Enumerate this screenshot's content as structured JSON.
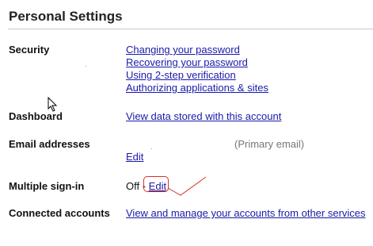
{
  "page": {
    "title": "Personal Settings"
  },
  "sections": {
    "security": {
      "label": "Security",
      "links": [
        "Changing your password",
        "Recovering your password",
        "Using 2-step verification",
        "Authorizing applications & sites"
      ]
    },
    "dashboard": {
      "label": "Dashboard",
      "link": "View data stored with this account"
    },
    "email": {
      "label": "Email addresses",
      "primary_note": "(Primary email)",
      "edit": "Edit"
    },
    "multiple_signin": {
      "label": "Multiple sign-in",
      "status": "Off",
      "separator": " - ",
      "edit": "Edit"
    },
    "connected": {
      "label": "Connected accounts",
      "link": "View and manage your accounts from other services"
    }
  },
  "colors": {
    "link": "#1a1aa8",
    "annotation": "#d9302a",
    "muted": "#767676",
    "rule": "#c9c9c9"
  },
  "icons": {
    "cursor": "mouse-pointer-icon"
  }
}
